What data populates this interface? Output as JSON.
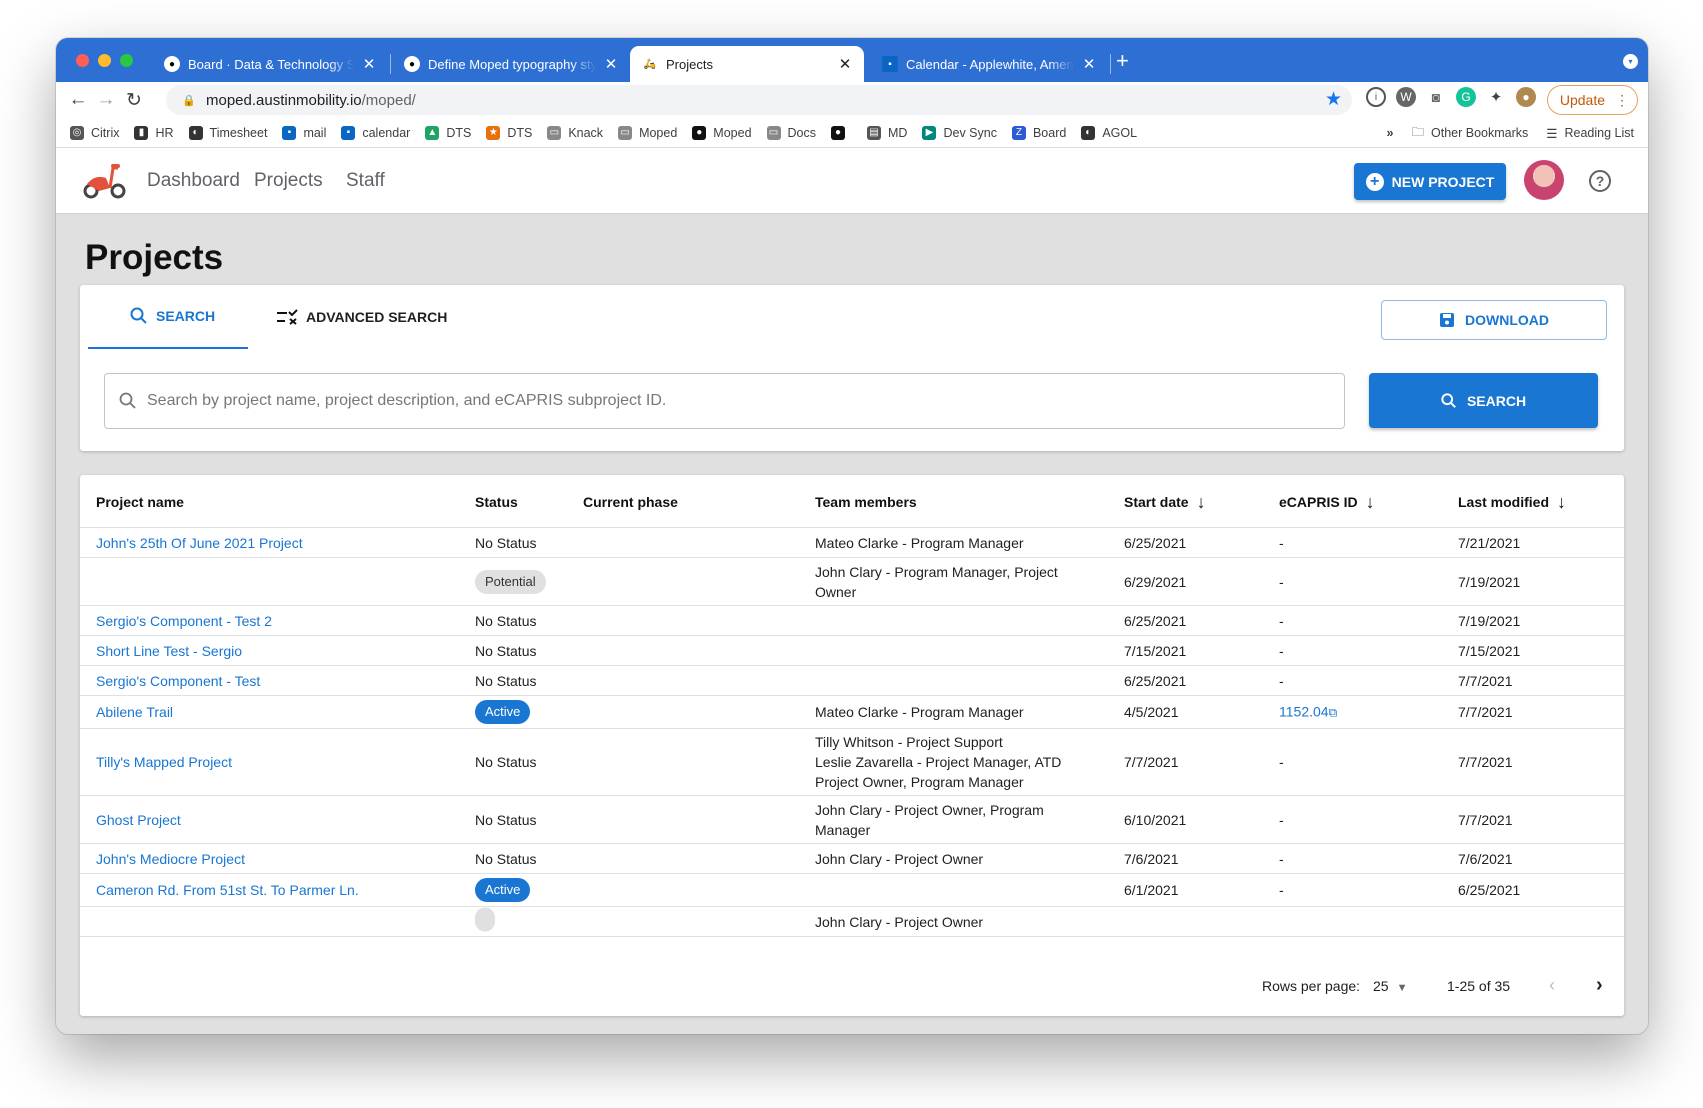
{
  "browser": {
    "tabs": [
      {
        "title": "Board · Data & Technology Ser",
        "icon": "github-icon"
      },
      {
        "title": "Define Moped typography styles",
        "icon": "github-icon"
      },
      {
        "title": "Projects",
        "icon": "moped-icon"
      },
      {
        "title": "Calendar - Applewhite, Amenity",
        "icon": "outlook-icon"
      }
    ],
    "url_host": "moped.austinmobility.io",
    "url_path": "/moped/",
    "update_label": "Update",
    "bookmarks": [
      {
        "label": "Citrix",
        "icon": "citrix-icon"
      },
      {
        "label": "HR",
        "icon": "hr-icon"
      },
      {
        "label": "Timesheet",
        "icon": "globe-icon"
      },
      {
        "label": "mail",
        "icon": "outlook-icon"
      },
      {
        "label": "calendar",
        "icon": "calendar-icon"
      },
      {
        "label": "DTS",
        "icon": "drive-icon"
      },
      {
        "label": "DTS",
        "icon": "star-icon"
      },
      {
        "label": "Knack",
        "icon": "folder-icon"
      },
      {
        "label": "Moped",
        "icon": "folder-icon"
      },
      {
        "label": "Moped",
        "icon": "github-icon"
      },
      {
        "label": "Docs",
        "icon": "folder-icon"
      },
      {
        "label": "",
        "icon": "github-icon"
      },
      {
        "label": "MD",
        "icon": "doc-icon"
      },
      {
        "label": "Dev Sync",
        "icon": "meet-icon"
      },
      {
        "label": "Board",
        "icon": "zenhub-icon"
      },
      {
        "label": "AGOL",
        "icon": "globe-icon"
      }
    ],
    "other_bookmarks": "Other Bookmarks",
    "reading_list": "Reading List",
    "overflow": "»"
  },
  "app": {
    "nav": [
      "Dashboard",
      "Projects",
      "Staff"
    ],
    "new_project_label": "NEW PROJECT",
    "help_label": "?"
  },
  "page": {
    "title": "Projects",
    "tab_search": "SEARCH",
    "tab_advanced": "ADVANCED SEARCH",
    "download_label": "DOWNLOAD",
    "search_placeholder": "Search by project name, project description, and eCAPRIS subproject ID.",
    "search_button": "SEARCH"
  },
  "table": {
    "headers": [
      "Project name",
      "Status",
      "Current phase",
      "Team members",
      "Start date",
      "eCAPRIS ID",
      "Last modified"
    ],
    "rows": [
      {
        "name": "John's 25th Of June 2021 Project",
        "status": "No Status",
        "status_type": "text",
        "phase": "",
        "team": [
          "Mateo Clarke - Program Manager"
        ],
        "start": "6/25/2021",
        "ecapris": "-",
        "modified": "7/21/2021"
      },
      {
        "name": "",
        "status": "Potential",
        "status_type": "potential",
        "phase": "",
        "team": [
          "John Clary - Program Manager, Project",
          "Owner"
        ],
        "start": "6/29/2021",
        "ecapris": "-",
        "modified": "7/19/2021"
      },
      {
        "name": "Sergio's Component - Test 2",
        "status": "No Status",
        "status_type": "text",
        "phase": "",
        "team": [],
        "start": "6/25/2021",
        "ecapris": "-",
        "modified": "7/19/2021"
      },
      {
        "name": "Short Line Test - Sergio",
        "status": "No Status",
        "status_type": "text",
        "phase": "",
        "team": [],
        "start": "7/15/2021",
        "ecapris": "-",
        "modified": "7/15/2021"
      },
      {
        "name": "Sergio's Component - Test",
        "status": "No Status",
        "status_type": "text",
        "phase": "",
        "team": [],
        "start": "6/25/2021",
        "ecapris": "-",
        "modified": "7/7/2021"
      },
      {
        "name": "Abilene Trail",
        "status": "Active",
        "status_type": "active",
        "phase": "",
        "team": [
          "Mateo Clarke - Program Manager"
        ],
        "start": "4/5/2021",
        "ecapris": "1152.04",
        "modified": "7/7/2021"
      },
      {
        "name": "Tilly's Mapped Project",
        "status": "No Status",
        "status_type": "text",
        "phase": "",
        "team": [
          "Tilly Whitson - Project Support",
          "Leslie Zavarella - Project Manager, ATD",
          "Project Owner, Program Manager"
        ],
        "start": "7/7/2021",
        "ecapris": "-",
        "modified": "7/7/2021"
      },
      {
        "name": "Ghost Project",
        "status": "No Status",
        "status_type": "text",
        "phase": "",
        "team": [
          "John Clary - Project Owner, Program",
          "Manager"
        ],
        "start": "6/10/2021",
        "ecapris": "-",
        "modified": "7/7/2021"
      },
      {
        "name": "John's Mediocre Project",
        "status": "No Status",
        "status_type": "text",
        "phase": "",
        "team": [
          "John Clary - Project Owner"
        ],
        "start": "7/6/2021",
        "ecapris": "-",
        "modified": "7/6/2021"
      },
      {
        "name": "Cameron Rd. From 51st St. To Parmer Ln.",
        "status": "Active",
        "status_type": "active",
        "phase": "",
        "team": [],
        "start": "6/1/2021",
        "ecapris": "-",
        "modified": "6/25/2021"
      },
      {
        "name": "",
        "status": "",
        "status_type": "potential",
        "phase": "",
        "team": [
          "John Clary - Project Owner"
        ],
        "start": "",
        "ecapris": "",
        "modified": ""
      }
    ]
  },
  "pagination": {
    "rows_per_page_label": "Rows per page:",
    "rows_per_page": "25",
    "range": "1-25 of 35"
  }
}
